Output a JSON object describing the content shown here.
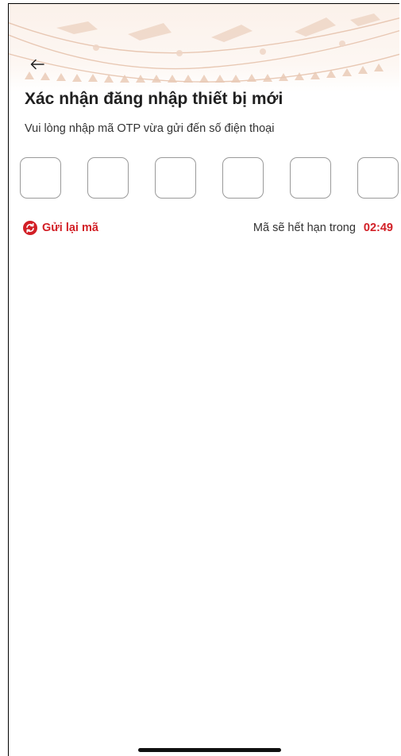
{
  "header": {
    "back_icon": "arrow-left-icon",
    "title": "Xác nhận đăng nhập thiết bị mới",
    "subtitle": "Vui lòng nhập mã OTP vừa gửi đến số điện thoại"
  },
  "otp": {
    "digits": [
      "",
      "",
      "",
      "",
      "",
      ""
    ]
  },
  "resend": {
    "icon": "refresh-icon",
    "label": "Gửi lại mã"
  },
  "expiry": {
    "text": "Mã sẽ hết hạn trong",
    "countdown": "02:49"
  },
  "colors": {
    "accent": "#d21f26",
    "pattern": "#e9c9b4",
    "box_border": "#9a9a9a"
  }
}
